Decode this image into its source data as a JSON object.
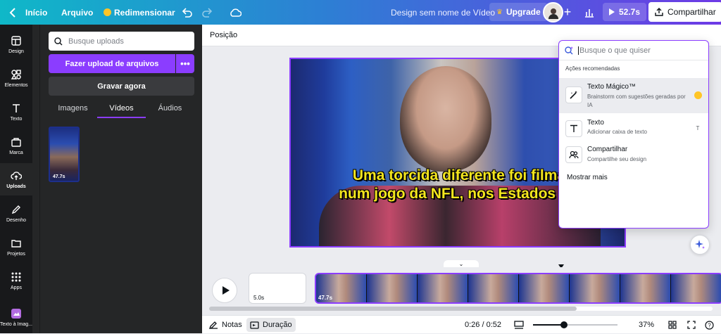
{
  "topbar": {
    "home": "Início",
    "file": "Arquivo",
    "resize": "Redimensionar",
    "design_title": "Design sem nome de Vídeo",
    "upgrade": "Upgrade",
    "duration": "52.7s",
    "share": "Compartilhar"
  },
  "sidenav": {
    "items": [
      {
        "label": "Design",
        "icon": "layout-icon"
      },
      {
        "label": "Elementos",
        "icon": "shapes-icon"
      },
      {
        "label": "Texto",
        "icon": "text-icon"
      },
      {
        "label": "Marca",
        "icon": "brand-icon"
      },
      {
        "label": "Uploads",
        "icon": "upload-cloud-icon"
      },
      {
        "label": "Desenho",
        "icon": "pen-icon"
      },
      {
        "label": "Projetos",
        "icon": "folder-icon"
      },
      {
        "label": "Apps",
        "icon": "grid-icon"
      },
      {
        "label": "Texto à Imag...",
        "icon": "text-to-image-icon"
      }
    ]
  },
  "uploads_panel": {
    "search_placeholder": "Busque uploads",
    "upload_button": "Fazer upload de arquivos",
    "record_button": "Gravar agora",
    "tabs": [
      "Imagens",
      "Vídeos",
      "Áudios"
    ],
    "active_tab": "Vídeos",
    "thumb_duration": "47.7s"
  },
  "context_toolbar": {
    "position": "Posição"
  },
  "video": {
    "caption_line1": "Uma torcida diferente foi filma",
    "caption_line2": "num jogo da NFL, nos Estados Un"
  },
  "popup": {
    "search_placeholder": "Busque o que quiser",
    "section_title": "Ações recomendadas",
    "actions": [
      {
        "title": "Texto Mágico™",
        "desc": "Brainstorm com sugestões geradas por IA",
        "icon": "magic-write-icon",
        "badge": "crown-icon"
      },
      {
        "title": "Texto",
        "desc": "Adicionar caixa de texto",
        "icon": "text-icon",
        "badge": "T"
      },
      {
        "title": "Compartilhar",
        "desc": "Compartilhe seu design",
        "icon": "people-icon",
        "badge": ""
      }
    ],
    "show_more": "Mostrar mais"
  },
  "timeline": {
    "blank_clip_duration": "5.0s",
    "video_clip_duration": "47.7s",
    "scroll_fraction": 0.73
  },
  "bottombar": {
    "notes": "Notas",
    "duration": "Duração",
    "time": "0:26 / 0:52",
    "zoom": "37%",
    "zoom_fraction": 0.37
  },
  "colors": {
    "accent": "#8b3dff",
    "caption": "#f4e61e",
    "sidebar": "#18191b"
  }
}
